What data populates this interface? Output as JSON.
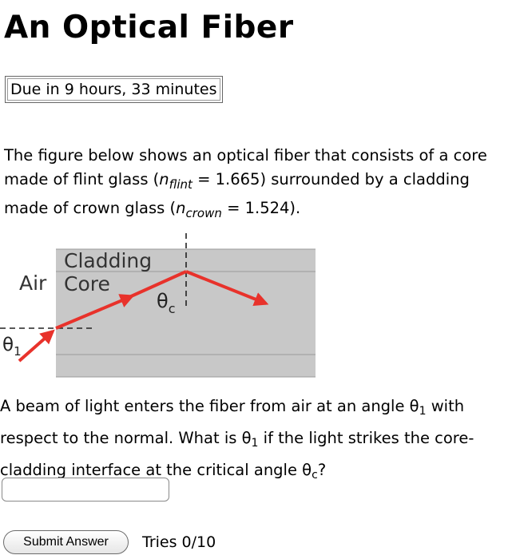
{
  "page": {
    "title": "An Optical Fiber",
    "due": "Due in 9 hours, 33 minutes"
  },
  "problem": {
    "intro_1": "The figure below shows an optical fiber that consists of a core made of flint glass (",
    "n_flint_sym": "n",
    "n_flint_sub": "flint",
    "n_flint_val": " = 1.665) surrounded by a cladding made of crown glass (",
    "n_crown_sym": "n",
    "n_crown_sub": "crown",
    "n_crown_val": " = 1.524).",
    "q_1": "A beam of light enters the fiber from air at an angle θ",
    "q_sub1": "1",
    "q_2": " with respect to the normal. What is θ",
    "q_sub2": "1",
    "q_3": " if the light strikes the core-cladding interface at the critical angle θ",
    "q_sub3": "c",
    "q_4": "?"
  },
  "figure": {
    "label_cladding": "Cladding",
    "label_air": "Air",
    "label_core": "Core",
    "label_theta_c": "θc",
    "label_theta_1": "θ1",
    "ray_color": "#e8322b",
    "fiber_color": "#c8c8c8"
  },
  "controls": {
    "answer_value": "",
    "submit_label": "Submit Answer",
    "tries": "Tries 0/10"
  }
}
